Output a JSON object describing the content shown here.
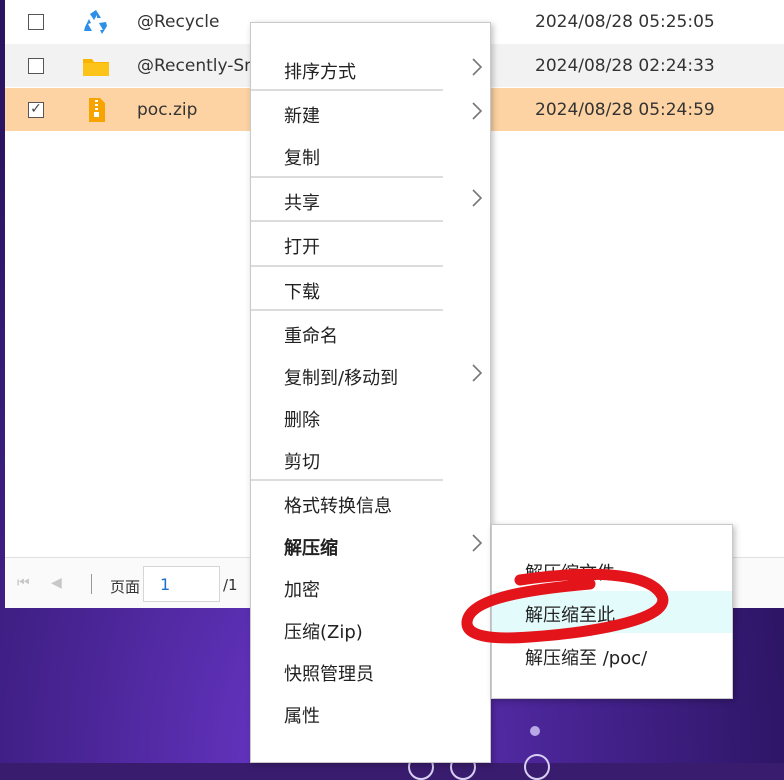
{
  "files": [
    {
      "name": "@Recycle",
      "date": "2024/08/28 05:25:05",
      "checked": false,
      "icon": "recycle-icon"
    },
    {
      "name": "@Recently-Sna",
      "date": "2024/08/28 02:24:33",
      "checked": false,
      "icon": "folder-icon"
    },
    {
      "name": "poc.zip",
      "date": "2024/08/28 05:24:59",
      "checked": true,
      "icon": "zip-file-icon"
    }
  ],
  "pagination": {
    "page_label": "页面",
    "page_value": "1",
    "total": "/1"
  },
  "context_menu": {
    "items": [
      {
        "label": "排序方式",
        "submenu": true
      },
      {
        "label": "新建",
        "submenu": true
      },
      {
        "label": "复制",
        "submenu": false
      },
      {
        "label": "共享",
        "submenu": true
      },
      {
        "label": "打开",
        "submenu": false
      },
      {
        "label": "下载",
        "submenu": false
      },
      {
        "label": "重命名",
        "submenu": false
      },
      {
        "label": "复制到/移动到",
        "submenu": true
      },
      {
        "label": "删除",
        "submenu": false
      },
      {
        "label": "剪切",
        "submenu": false
      },
      {
        "label": "格式转换信息",
        "submenu": false
      },
      {
        "label": "解压缩",
        "submenu": true,
        "active": true
      },
      {
        "label": "加密",
        "submenu": false
      },
      {
        "label": "压缩(Zip)",
        "submenu": false
      },
      {
        "label": "快照管理员",
        "submenu": false
      },
      {
        "label": "属性",
        "submenu": false
      }
    ]
  },
  "extract_submenu": {
    "items": [
      {
        "label": "解压缩文件"
      },
      {
        "label": "解压缩至此",
        "highlighted": true
      },
      {
        "label": "解压缩至 /poc/"
      }
    ]
  },
  "colors": {
    "selected_row": "#fdd3a3",
    "highlight": "#e3fbfb",
    "annotation": "#e4141b",
    "desktop": "#4a2596"
  }
}
